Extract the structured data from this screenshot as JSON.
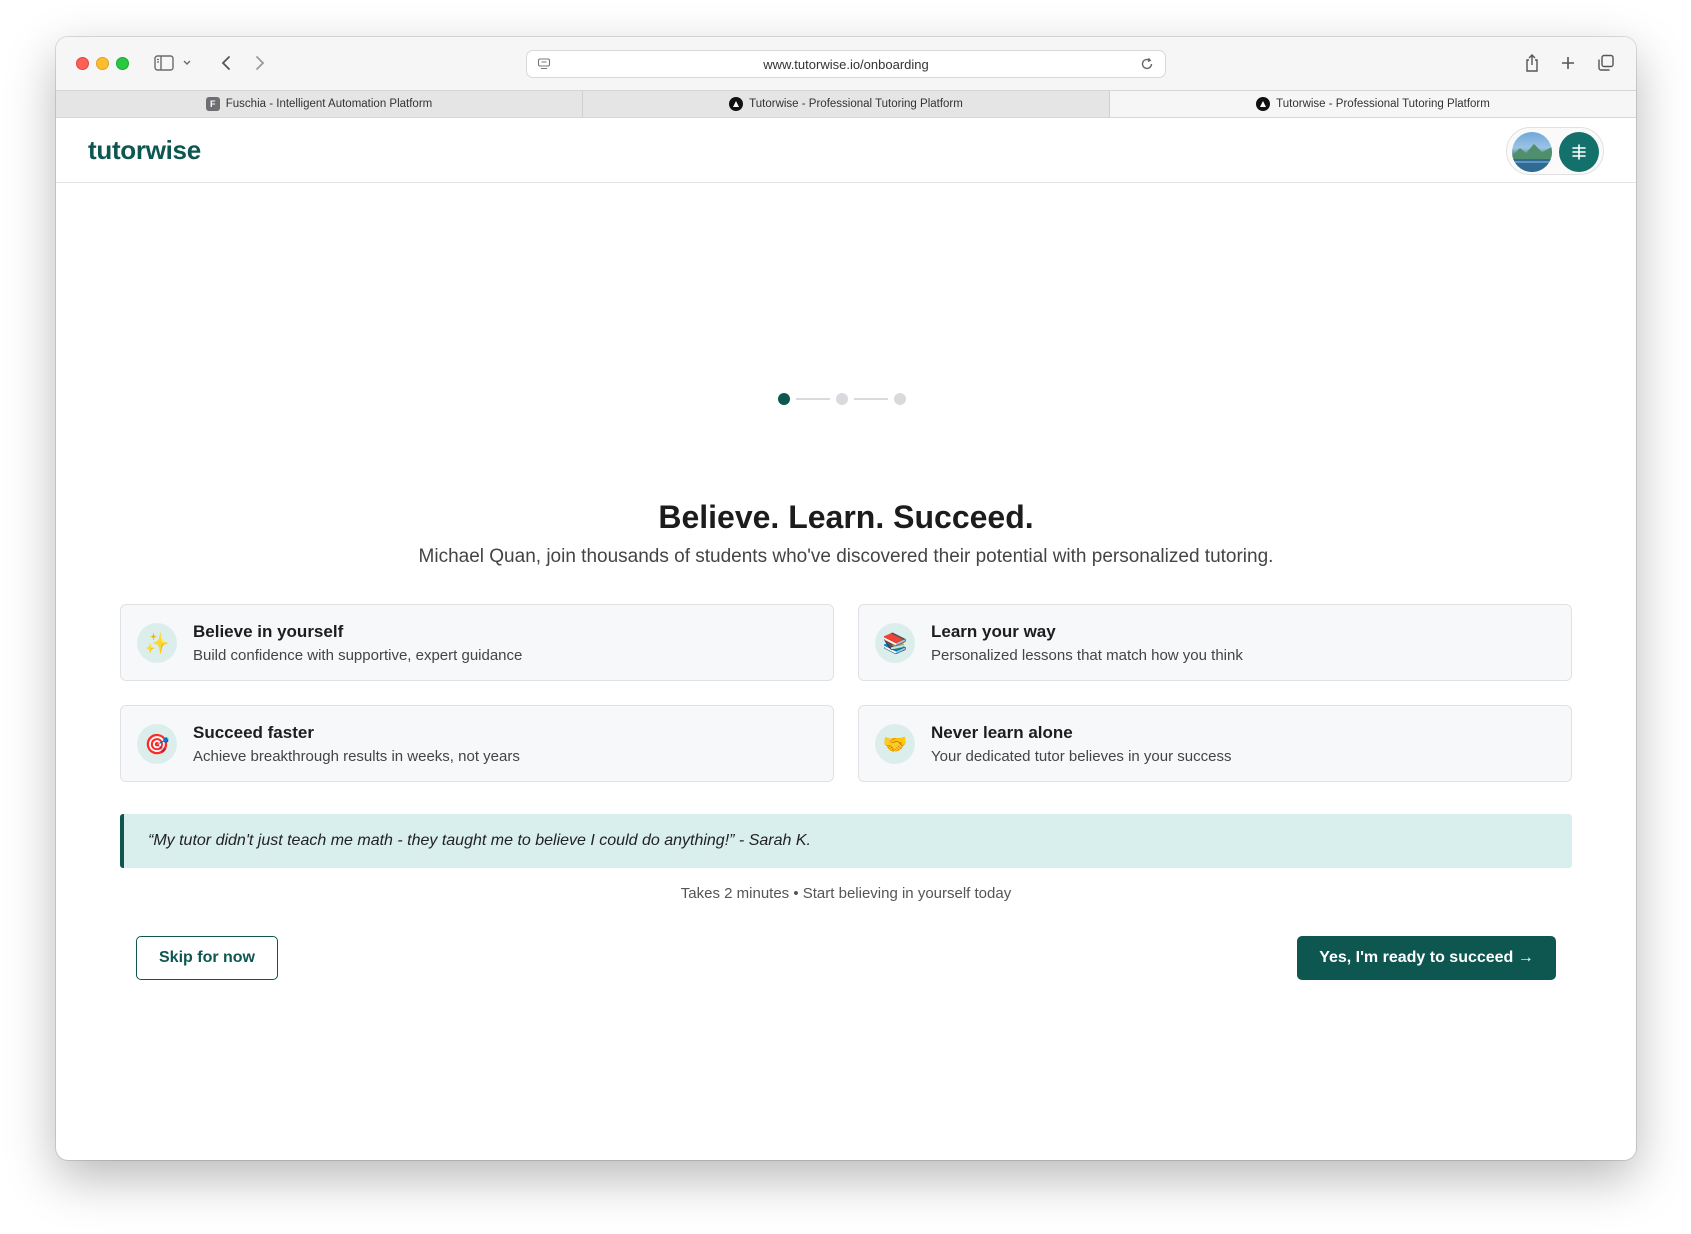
{
  "browser": {
    "url": "www.tutorwise.io/onboarding",
    "tabs": [
      {
        "label": "Fuschia - Intelligent Automation Platform",
        "favicon": "F",
        "active": false
      },
      {
        "label": "Tutorwise - Professional Tutoring Platform",
        "active": false
      },
      {
        "label": "Tutorwise - Professional Tutoring Platform",
        "active": true
      }
    ]
  },
  "header": {
    "logo": "tutorwise",
    "brand_color": "#0e5751"
  },
  "onboarding": {
    "steps_total": 3,
    "current_step": 1,
    "headline": "Believe. Learn. Succeed.",
    "subline": "Michael Quan, join thousands of students who've discovered their potential with personalized tutoring.",
    "features": [
      {
        "icon": "sparkles-icon",
        "emoji": "✨",
        "title": "Believe in yourself",
        "desc": "Build confidence with supportive, expert guidance"
      },
      {
        "icon": "books-icon",
        "emoji": "📚",
        "title": "Learn your way",
        "desc": "Personalized lessons that match how you think"
      },
      {
        "icon": "target-icon",
        "emoji": "🎯",
        "title": "Succeed faster",
        "desc": "Achieve breakthrough results in weeks, not years"
      },
      {
        "icon": "handshake-icon",
        "emoji": "🤝",
        "title": "Never learn alone",
        "desc": "Your dedicated tutor believes in your success"
      }
    ],
    "quote": "“My tutor didn't just teach me math - they taught me to believe I could do anything!” - Sarah K.",
    "hint": "Takes 2 minutes • Start believing in yourself today",
    "skip_label": "Skip for now",
    "cta_label": "Yes, I'm ready to succeed →"
  }
}
